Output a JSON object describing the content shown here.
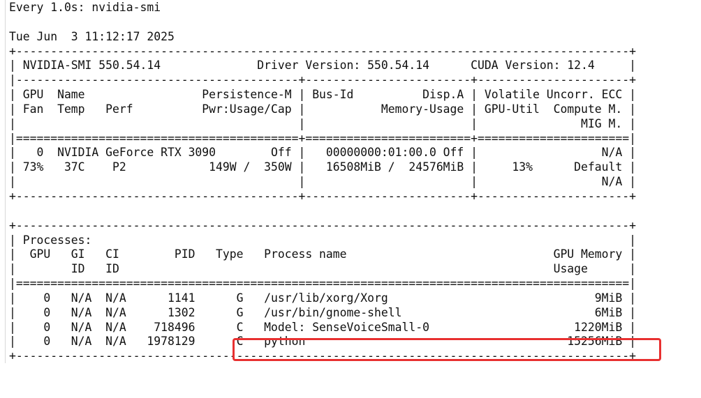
{
  "terminal": {
    "lines": [
      "Every 1.0s: nvidia-smi",
      "",
      "Tue Jun  3 11:12:17 2025",
      "+-----------------------------------------------------------------------------------------+",
      "| NVIDIA-SMI 550.54.14              Driver Version: 550.54.14      CUDA Version: 12.4     |",
      "|-----------------------------------------+------------------------+----------------------+",
      "| GPU  Name                 Persistence-M | Bus-Id          Disp.A | Volatile Uncorr. ECC |",
      "| Fan  Temp   Perf          Pwr:Usage/Cap |           Memory-Usage | GPU-Util  Compute M. |",
      "|                                         |                        |               MIG M. |",
      "|=========================================+========================+======================|",
      "|   0  NVIDIA GeForce RTX 3090        Off |   00000000:01:00.0 Off |                  N/A |",
      "| 73%   37C    P2            149W /  350W |   16508MiB /  24576MiB |     13%      Default |",
      "|                                         |                        |                  N/A |",
      "+-----------------------------------------+------------------------+----------------------+",
      "",
      "+-----------------------------------------------------------------------------------------+",
      "| Processes:                                                                              |",
      "|  GPU   GI   CI        PID   Type   Process name                              GPU Memory |",
      "|        ID   ID                                                               Usage      |",
      "|=========================================================================================|",
      "|    0   N/A  N/A      1141      G   /usr/lib/xorg/Xorg                              9MiB |",
      "|    0   N/A  N/A      1302      G   /usr/bin/gnome-shell                            6MiB |",
      "|    0   N/A  N/A    718496      C   Model: SenseVoiceSmall-0                     1220MiB |",
      "|    0   N/A  N/A   1978129      C   python                                      15256MiB |",
      "+-----------------------------------------------------------------------------------------+"
    ]
  },
  "colors": {
    "background": "#ffffff",
    "text": "#101010",
    "highlight": "#e83030"
  }
}
